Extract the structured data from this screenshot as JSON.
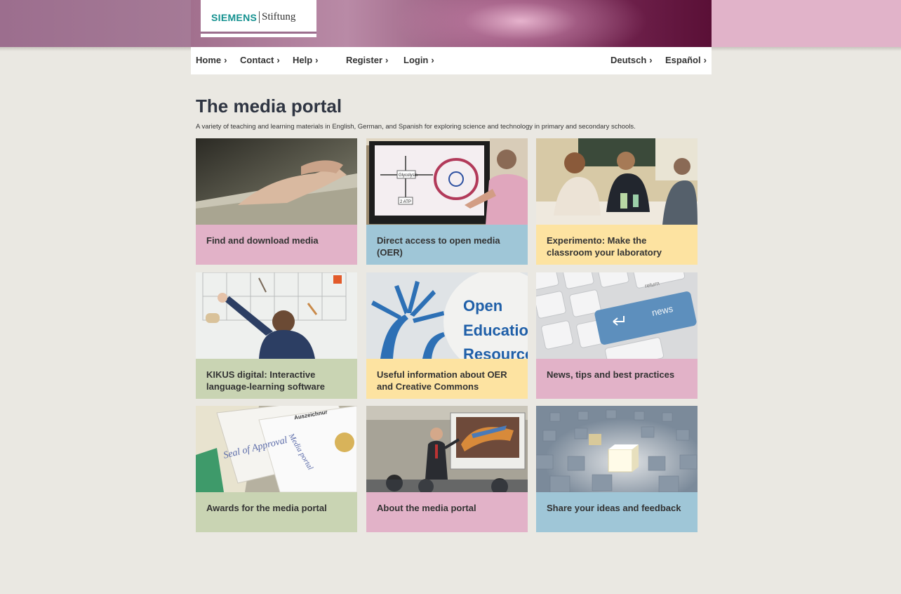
{
  "header": {
    "logo_brand": "SIEMENS",
    "logo_sub": "Stiftung"
  },
  "nav": {
    "left": [
      {
        "label": "Home"
      },
      {
        "label": "Contact"
      },
      {
        "label": "Help"
      },
      {
        "label": "Register"
      },
      {
        "label": "Login"
      }
    ],
    "right": [
      {
        "label": "Deutsch"
      },
      {
        "label": "Español"
      }
    ]
  },
  "main": {
    "title": "The media portal",
    "subtitle": "A variety of teaching and learning materials in English, German, and Spanish for exploring science and technology in primary and secondary schools."
  },
  "tiles": [
    {
      "label": "Find and download media",
      "color": "#e2b2c8",
      "icon": "touchpad-hand-image"
    },
    {
      "label": "Direct access to open media (OER)",
      "color": "#9fc6d7",
      "icon": "smartboard-diagram-image"
    },
    {
      "label": "Experimento: Make the classroom your laboratory",
      "color": "#fde3a1",
      "icon": "classroom-experiment-image"
    },
    {
      "label": "KIKUS digital: Interactive language-learning software",
      "color": "#c9d4b3",
      "icon": "child-whiteboard-image"
    },
    {
      "label": "Useful information about OER and Creative Commons",
      "color": "#fde3a1",
      "icon": "open-education-resources-image"
    },
    {
      "label": "News, tips and best practices",
      "color": "#e2b2c8",
      "icon": "news-keyboard-image"
    },
    {
      "label": "Awards for the media portal",
      "color": "#c9d4b3",
      "icon": "award-certificates-image"
    },
    {
      "label": "About the media portal",
      "color": "#e2b2c8",
      "icon": "presentation-classroom-image"
    },
    {
      "label": "Share your ideas and feedback",
      "color": "#9fc6d7",
      "icon": "glowing-cube-image"
    }
  ],
  "image_texts": {
    "glycolysis": "Glycolysis",
    "atp": "2 ATP",
    "open": "Open",
    "education": "Education",
    "resources": "Resources",
    "news": "news",
    "return": "return",
    "seal": "Seal of Approval",
    "media_portal": "Media portal",
    "auszeichnung": "Auszeichnur"
  }
}
